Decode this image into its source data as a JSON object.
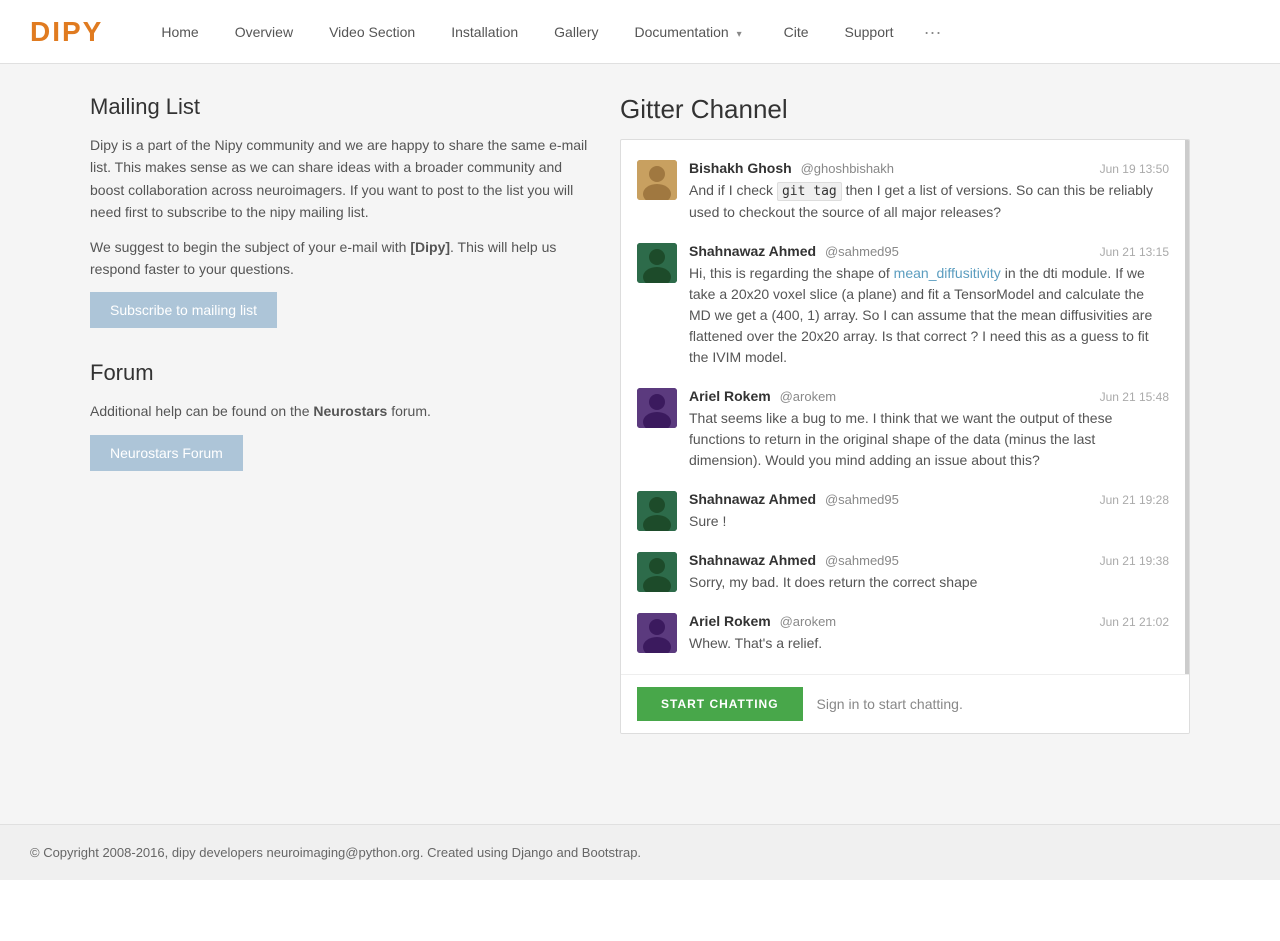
{
  "navbar": {
    "brand": "DIPY",
    "links": [
      {
        "label": "Home",
        "href": "#"
      },
      {
        "label": "Overview",
        "href": "#"
      },
      {
        "label": "Video Section",
        "href": "#"
      },
      {
        "label": "Installation",
        "href": "#"
      },
      {
        "label": "Gallery",
        "href": "#"
      },
      {
        "label": "Documentation",
        "href": "#",
        "dropdown": true
      },
      {
        "label": "Cite",
        "href": "#"
      },
      {
        "label": "Support",
        "href": "#"
      },
      {
        "label": "···",
        "href": "#",
        "more": true
      }
    ]
  },
  "mailing": {
    "title": "Mailing List",
    "para1": "Dipy is a part of the Nipy community and we are happy to share the same e-mail list. This makes sense as we can share ideas with a broader community and boost collaboration across neuroimagers. If you want to post to the list you will need first to subscribe to the nipy mailing list.",
    "para2_prefix": "We suggest to begin the subject of your e-mail with ",
    "para2_bold": "[Dipy]",
    "para2_suffix": ". This will help us respond faster to your questions.",
    "subscribe_btn": "Subscribe to mailing list"
  },
  "forum": {
    "title": "Forum",
    "text_prefix": "Additional help can be found on the ",
    "text_bold": "Neurostars",
    "text_suffix": " forum.",
    "btn": "Neurostars Forum"
  },
  "gitter": {
    "title": "Gitter Channel",
    "messages": [
      {
        "id": "msg1",
        "author": "Bishakh Ghosh",
        "handle": "@ghoshbishakh",
        "time": "Jun 19 13:50",
        "text": "And if I check git tag then I get a list of versions. So can this be reliably used to checkout the source of all major releases?",
        "avatar_type": "bishakh",
        "has_code": true,
        "code": "git tag",
        "text_before": "And if I check ",
        "text_after": " then I get a list of versions. So can this be reliably used to checkout the source of all major releases?"
      },
      {
        "id": "msg2",
        "author": "Shahnawaz Ahmed",
        "handle": "@sahmed95",
        "time": "Jun 21 13:15",
        "avatar_type": "shahnawaz",
        "text": "Hi, this is regarding the shape of mean_diffusitivity in the dti module. If we take a 20x20 voxel slice (a plane) and fit a TensorModel and calculate the MD we get a (400, 1) array. So I can assume that the mean diffusivities are flattened over the 20x20 array. Is that correct ? I need this as a guess to fit the IVIM model.",
        "has_link": true,
        "link_text": "mean_diffusitivity",
        "text_before": "Hi, this is regarding the shape of ",
        "text_after": " in the dti module. If we take a 20x20 voxel slice (a plane) and fit a TensorModel and calculate the MD we get a (400, 1) array. So I can assume that the mean diffusivities are flattened over the 20x20 array. Is that correct ? I need this as a guess to fit the IVIM model."
      },
      {
        "id": "msg3",
        "author": "Ariel Rokem",
        "handle": "@arokem",
        "time": "Jun 21 15:48",
        "avatar_type": "ariel",
        "text": "That seems like a bug to me. I think that we want the output of these functions to return in the original shape of the data (minus the last dimension). Would you mind adding an issue about this?"
      },
      {
        "id": "msg4",
        "author": "Shahnawaz Ahmed",
        "handle": "@sahmed95",
        "time": "Jun 21 19:28",
        "avatar_type": "shahnawaz",
        "text": "Sure !"
      },
      {
        "id": "msg5",
        "author": "Shahnawaz Ahmed",
        "handle": "@sahmed95",
        "time": "Jun 21 19:38",
        "avatar_type": "shahnawaz",
        "text": "Sorry, my bad. It does return the correct shape"
      },
      {
        "id": "msg6",
        "author": "Ariel Rokem",
        "handle": "@arokem",
        "time": "Jun 21 21:02",
        "avatar_type": "ariel",
        "text": "Whew. That's a relief."
      }
    ],
    "start_btn": "START CHATTING",
    "sign_in_text": "Sign in to start chatting."
  },
  "footer": {
    "text": "© Copyright 2008-2016, dipy developers neuroimaging@python.org. Created using Django and Bootstrap."
  }
}
